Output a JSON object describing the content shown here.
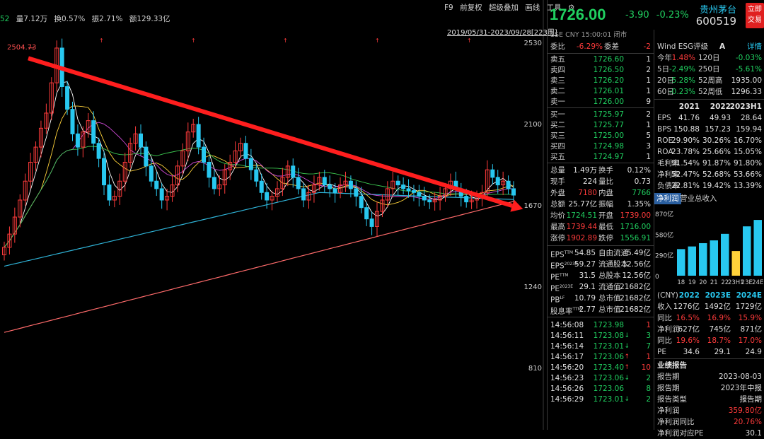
{
  "top_info": {
    "lead": "52",
    "volume": "量7.12万",
    "turnover": "换0.57%",
    "amplitude": "振2.71%",
    "amount": "额129.33亿"
  },
  "toolbar": {
    "f9": "F9",
    "adjust": "前复权",
    "overlay": "超级叠加",
    "draw": "画线",
    "tools": "工具",
    "settings_icon": "gear-icon"
  },
  "range_label": "2019/05/31-2023/09/28[223周]",
  "y_axis": {
    "ticks": [
      "2530",
      "2100",
      "1670",
      "1240",
      "810"
    ],
    "max_label": "2504.73"
  },
  "colors": {
    "up": "#ff3b3b",
    "down": "#28c8f0",
    "green": "#20d060",
    "yellow": "#ffd23a",
    "trendline": "#ff1e1e",
    "ma_long": "#ff6b6b"
  },
  "chart_data": {
    "type": "candlestick",
    "x_range": [
      "2019/05/31",
      "2023/09/28"
    ],
    "periods": 223,
    "ylim": [
      810,
      2530
    ],
    "max_label": 2504.73,
    "trend_line": {
      "from": 2450,
      "to": 1670
    },
    "closes": [
      1450,
      1520,
      1610,
      1700,
      1800,
      1900,
      1980,
      2080,
      2160,
      2320,
      2504,
      2300,
      2180,
      2050,
      1980,
      2060,
      2120,
      2000,
      1920,
      1780,
      1700,
      1720,
      1800,
      1900,
      2000,
      2050,
      1980,
      1880,
      1800,
      1760,
      1700,
      1720,
      1780,
      1880,
      1960,
      2060,
      2100,
      1980,
      1900,
      1820,
      1760,
      1780,
      1860,
      1900,
      1960,
      2000,
      1920,
      1860,
      1800,
      1740,
      1700,
      1720,
      1760,
      1820,
      1880,
      1820,
      1760,
      1700,
      1740,
      1780,
      1820,
      1780,
      1760,
      1740,
      1780,
      1800,
      1760,
      1720,
      1660,
      1600,
      1560,
      1640,
      1700,
      1760,
      1800,
      1780,
      1760,
      1750,
      1740,
      1720,
      1700,
      1690,
      1700,
      1720,
      1760,
      1800,
      1760,
      1720,
      1690,
      1700,
      1720,
      1740,
      1860,
      1820,
      1780,
      1800,
      1760,
      1726
    ]
  },
  "quote": {
    "name": "贵州茅台",
    "code": "600519",
    "trade_button": "立即交易",
    "price": "1726.00",
    "change": "-3.90",
    "change_pct": "-0.23%",
    "sub": "SSE  CNY  15:00:01  闭市",
    "wei_bi_label": "委比",
    "wei_bi": "-6.29%",
    "wei_cha_label": "委差",
    "wei_cha": "-2"
  },
  "order_book": {
    "asks": [
      {
        "label": "卖五",
        "price": "1726.60",
        "vol": "1"
      },
      {
        "label": "卖四",
        "price": "1726.50",
        "vol": "2"
      },
      {
        "label": "卖三",
        "price": "1726.20",
        "vol": "1"
      },
      {
        "label": "卖二",
        "price": "1726.01",
        "vol": "1"
      },
      {
        "label": "卖一",
        "price": "1726.00",
        "vol": "9"
      }
    ],
    "bids": [
      {
        "label": "买一",
        "price": "1725.97",
        "vol": "2"
      },
      {
        "label": "买二",
        "price": "1725.77",
        "vol": "1"
      },
      {
        "label": "买三",
        "price": "1725.00",
        "vol": "5"
      },
      {
        "label": "买四",
        "price": "1724.98",
        "vol": "3"
      },
      {
        "label": "买五",
        "price": "1724.97",
        "vol": "1"
      }
    ]
  },
  "stats": [
    {
      "l1": "总量",
      "v1": "1.49万",
      "c1": "w",
      "l2": "换手",
      "v2": "0.12%",
      "c2": "w"
    },
    {
      "l1": "现手",
      "v1": "224",
      "c1": "w",
      "l2": "量比",
      "v2": "0.73",
      "c2": "w"
    },
    {
      "l1": "外盘",
      "v1": "7180",
      "c1": "r",
      "l2": "内盘",
      "v2": "7766",
      "c2": "g"
    },
    {
      "l1": "总额",
      "v1": "25.77亿",
      "c1": "w",
      "l2": "振幅",
      "v2": "1.35%",
      "c2": "w"
    },
    {
      "l1": "均价",
      "v1": "1724.51",
      "c1": "g",
      "l2": "开盘",
      "v2": "1739.00",
      "c2": "r"
    },
    {
      "l1": "最高",
      "v1": "1739.44",
      "c1": "r",
      "l2": "最低",
      "v2": "1716.00",
      "c2": "g"
    },
    {
      "l1": "涨停",
      "v1": "1902.89",
      "c1": "r",
      "l2": "跌停",
      "v2": "1556.91",
      "c2": "g"
    }
  ],
  "valuation": [
    {
      "l1": "EPS",
      "s1": "TTM",
      "v1": "54.85",
      "l2": "自由流通",
      "v2": "5.49亿"
    },
    {
      "l1": "EPS",
      "s1": "2023E",
      "v1": "59.27",
      "l2": "流通股本",
      "v2": "12.56亿"
    },
    {
      "l1": "PE",
      "s1": "TTM",
      "v1": "31.5",
      "l2": "总股本",
      "v2": "12.56亿"
    },
    {
      "l1": "PE",
      "s1": "2023E",
      "v1": "29.1",
      "l2": "流通值",
      "v2": "21682亿"
    },
    {
      "l1": "PB",
      "s1": "LF",
      "v1": "10.79",
      "l2": "总市值",
      "v2": "21682亿"
    },
    {
      "l1": "股息率",
      "s1": "TTM",
      "v1": "2.77",
      "l2": "总市值",
      "v2": "21682亿"
    }
  ],
  "ticks": [
    {
      "time": "14:56:08",
      "price": "1723.98",
      "arrow": "",
      "vol": "1",
      "pc": "g",
      "vc": "r"
    },
    {
      "time": "14:56:11",
      "price": "1723.08",
      "arrow": "↓",
      "vol": "3",
      "pc": "g",
      "vc": "g"
    },
    {
      "time": "14:56:14",
      "price": "1723.01",
      "arrow": "↓",
      "vol": "7",
      "pc": "g",
      "vc": "g"
    },
    {
      "time": "14:56:17",
      "price": "1723.06",
      "arrow": "↑",
      "vol": "1",
      "pc": "g",
      "vc": "r"
    },
    {
      "time": "14:56:20",
      "price": "1723.40",
      "arrow": "↑",
      "vol": "10",
      "pc": "g",
      "vc": "r"
    },
    {
      "time": "14:56:23",
      "price": "1723.06",
      "arrow": "↓",
      "vol": "2",
      "pc": "g",
      "vc": "g"
    },
    {
      "time": "14:56:26",
      "price": "1723.06",
      "arrow": "",
      "vol": "8",
      "pc": "g",
      "vc": "g"
    },
    {
      "time": "14:56:29",
      "price": "1723.01",
      "arrow": "↓",
      "vol": "2",
      "pc": "g",
      "vc": "g"
    }
  ],
  "esg": {
    "label": "Wind ESG评级",
    "grade": "A",
    "detail": "详情"
  },
  "returns": [
    {
      "l1": "今年",
      "v1": "1.48%",
      "c1": "r",
      "l2": "120日",
      "v2": "-0.03%",
      "c2": "g"
    },
    {
      "l1": "5日",
      "v1": "-2.49%",
      "c1": "g",
      "l2": "250日",
      "v2": "-5.61%",
      "c2": "g"
    },
    {
      "l1": "20日",
      "v1": "-5.28%",
      "c1": "g",
      "l2": "52周高",
      "v2": "1935.00",
      "c2": "w"
    },
    {
      "l1": "60日",
      "v1": "-0.23%",
      "c1": "g",
      "l2": "52周低",
      "v2": "1296.33",
      "c2": "w"
    }
  ],
  "fin_header": [
    "2021",
    "2022",
    "2023H1"
  ],
  "fin_rows": [
    {
      "label": "EPS",
      "v": [
        "41.76",
        "49.93",
        "28.64"
      ]
    },
    {
      "label": "BPS",
      "v": [
        "150.88",
        "157.23",
        "159.94"
      ]
    },
    {
      "label": "ROE",
      "v": [
        "29.90%",
        "30.26%",
        "16.70%"
      ]
    },
    {
      "label": "ROA",
      "v": [
        "23.78%",
        "25.66%",
        "15.05%"
      ]
    },
    {
      "label": "毛利率",
      "v": [
        "91.54%",
        "91.87%",
        "91.80%"
      ]
    },
    {
      "label": "净利率",
      "v": [
        "52.47%",
        "52.68%",
        "53.66%"
      ]
    },
    {
      "label": "负债率",
      "v": [
        "22.81%",
        "19.42%",
        "13.39%"
      ]
    }
  ],
  "rev_tabs": [
    "净利润",
    "营业总收入"
  ],
  "rev_chart": {
    "type": "bar",
    "y_ticks": [
      "870亿",
      "580亿",
      "290亿",
      "0"
    ],
    "categories": [
      "18",
      "19",
      "20",
      "21",
      "22",
      "23H1",
      "23E",
      "24E"
    ],
    "values": [
      372,
      409,
      455,
      494,
      585,
      345,
      690,
      780
    ],
    "colors": [
      "#28c8f0",
      "#28c8f0",
      "#28c8f0",
      "#28c8f0",
      "#28c8f0",
      "#ffd23a",
      "#28c8f0",
      "#28c8f0"
    ]
  },
  "forecast_header": [
    "(CNY)",
    "2022",
    "2023E",
    "2024E"
  ],
  "forecast_rows": [
    {
      "label": "收入",
      "v": [
        "1276亿",
        "1492亿",
        "1729亿"
      ],
      "c": "w"
    },
    {
      "label": "同比",
      "v": [
        "16.5%",
        "16.9%",
        "15.9%"
      ],
      "c": "r"
    },
    {
      "label": "净利润",
      "v": [
        "627亿",
        "745亿",
        "871亿"
      ],
      "c": "w"
    },
    {
      "label": "同比",
      "v": [
        "19.6%",
        "18.7%",
        "17.0%"
      ],
      "c": "r"
    },
    {
      "label": "PE",
      "v": [
        "34.6",
        "29.1",
        "24.9"
      ],
      "c": "w"
    }
  ],
  "report": {
    "title": "业绩报告",
    "rows": [
      {
        "label": "报告期",
        "value": "2023-08-03",
        "c": "w"
      },
      {
        "label": "报告期",
        "value": "2023年中报",
        "c": "w"
      },
      {
        "label": "报告类型",
        "value": "报告期",
        "c": "w"
      },
      {
        "label": "净利润",
        "value": "359.80亿",
        "c": "r"
      },
      {
        "label": "净利润同比",
        "value": "20.76%",
        "c": "r"
      },
      {
        "label": "净利润对应PE",
        "value": "30.1",
        "c": "w"
      }
    ]
  }
}
